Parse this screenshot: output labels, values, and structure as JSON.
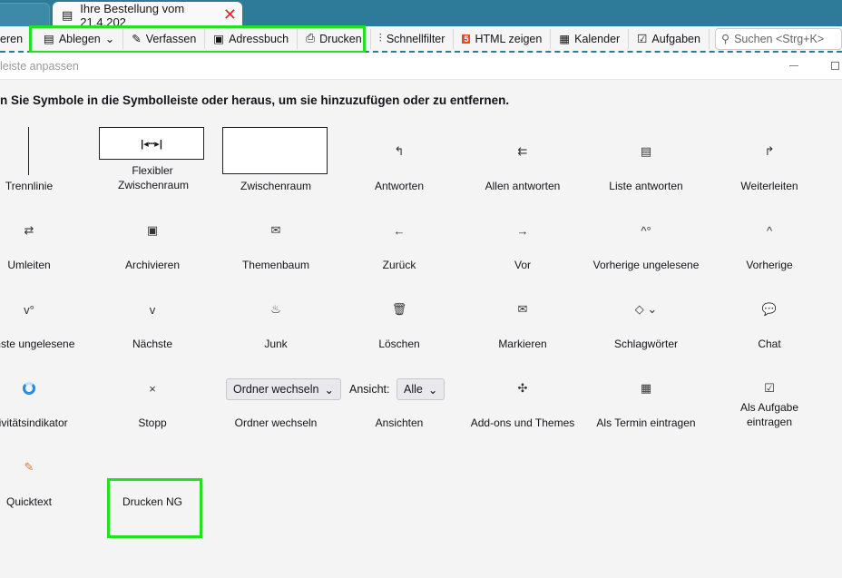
{
  "tabs": [
    {
      "label": ""
    },
    {
      "label": "Ihre Bestellung vom 21.4.202",
      "icon": "document-icon",
      "close_icon": "close-icon"
    }
  ],
  "toolbar": {
    "partial": "eren",
    "items": [
      {
        "label": "Ablegen",
        "icon": "file-icon",
        "dropdown": true
      },
      {
        "label": "Verfassen",
        "icon": "pencil-icon"
      },
      {
        "label": "Adressbuch",
        "icon": "address-book-icon"
      },
      {
        "label": "Drucken",
        "icon": "printer-icon"
      },
      {
        "label": "Schnellfilter",
        "icon": "filter-icon"
      },
      {
        "label": "HTML zeigen",
        "icon": "html5-icon"
      },
      {
        "label": "Kalender",
        "icon": "calendar-icon"
      },
      {
        "label": "Aufgaben",
        "icon": "tasks-icon"
      }
    ],
    "search_placeholder": "Suchen <Strg+K>"
  },
  "dialog": {
    "title": "leiste anpassen",
    "instruction": "n Sie Symbole in die Symbolleiste oder heraus, um sie hinzuzufügen oder zu entfernen."
  },
  "palette": [
    {
      "label": "Trennlinie"
    },
    {
      "label": "Flexibler Zwischenraum"
    },
    {
      "label": "Zwischenraum"
    },
    {
      "label": "Antworten",
      "glyph": "↰"
    },
    {
      "label": "Allen antworten",
      "glyph": "⇇"
    },
    {
      "label": "Liste antworten",
      "glyph": "▤"
    },
    {
      "label": "Weiterleiten",
      "glyph": "↱"
    },
    {
      "label": "Umleiten",
      "glyph": "⇄"
    },
    {
      "label": "Archivieren",
      "glyph": "▣"
    },
    {
      "label": "Themenbaum",
      "glyph": "✉"
    },
    {
      "label": "Zurück",
      "glyph": "←"
    },
    {
      "label": "Vor",
      "glyph": "→"
    },
    {
      "label": "Vorherige ungelesene",
      "glyph": "^°"
    },
    {
      "label": "Vorherige",
      "glyph": "^"
    },
    {
      "label": "ächste ungelesene",
      "glyph": "v°"
    },
    {
      "label": "Nächste",
      "glyph": "v"
    },
    {
      "label": "Junk",
      "glyph": "♨"
    },
    {
      "label": "Löschen",
      "glyph": "🗑"
    },
    {
      "label": "Markieren",
      "glyph": "✉"
    },
    {
      "label": "Schlagwörter",
      "glyph": "◇ ⌄"
    },
    {
      "label": "Chat",
      "glyph": "💬"
    },
    {
      "label": "ktivitätsindikator"
    },
    {
      "label": "Stopp",
      "glyph": "×"
    },
    {
      "label": "Ordner wechseln"
    },
    {
      "label": "Ansichten"
    },
    {
      "label": "Add-ons und Themes",
      "glyph": "✣"
    },
    {
      "label": "Als Termin eintragen",
      "glyph": "▦"
    },
    {
      "label": "Als Aufgabe eintragen",
      "glyph": "☑"
    },
    {
      "label": "Quicktext",
      "glyph": "✎"
    },
    {
      "label": "Drucken NG"
    }
  ],
  "folder_select": "Ordner wechseln",
  "view_label": "Ansicht:",
  "view_select": "Alle",
  "highlight_color": "#22e022",
  "accent_color": "#2e7b99"
}
